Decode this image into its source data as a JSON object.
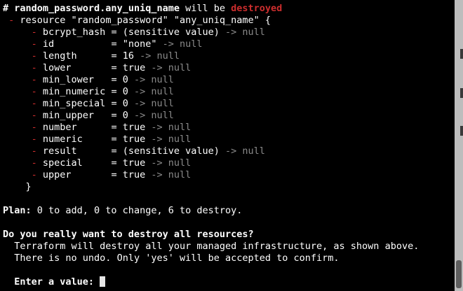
{
  "terminal": {
    "header": {
      "hash": "# ",
      "resource_name": "random_password.any_uniq_name",
      "will_be": " will be ",
      "action": "destroyed"
    },
    "resource_open": {
      "minus": "- ",
      "text": "resource \"random_password\" \"any_uniq_name\" {"
    },
    "attributes": [
      {
        "name": "bcrypt_hash = ",
        "value": "(sensitive value)",
        "arrow": " -> null"
      },
      {
        "name": "id          = ",
        "value": "\"none\"",
        "arrow": " -> null"
      },
      {
        "name": "length      = ",
        "value": "16",
        "arrow": " -> null"
      },
      {
        "name": "lower       = ",
        "value": "true",
        "arrow": " -> null"
      },
      {
        "name": "min_lower   = ",
        "value": "0",
        "arrow": " -> null"
      },
      {
        "name": "min_numeric = ",
        "value": "0",
        "arrow": " -> null"
      },
      {
        "name": "min_special = ",
        "value": "0",
        "arrow": " -> null"
      },
      {
        "name": "min_upper   = ",
        "value": "0",
        "arrow": " -> null"
      },
      {
        "name": "number      = ",
        "value": "true",
        "arrow": " -> null"
      },
      {
        "name": "numeric     = ",
        "value": "true",
        "arrow": " -> null"
      },
      {
        "name": "result      = ",
        "value": "(sensitive value)",
        "arrow": " -> null"
      },
      {
        "name": "special     = ",
        "value": "true",
        "arrow": " -> null"
      },
      {
        "name": "upper       = ",
        "value": "true",
        "arrow": " -> null"
      }
    ],
    "resource_close": "}",
    "plan": {
      "label": "Plan:",
      "text": " 0 to add, 0 to change, 6 to destroy."
    },
    "prompt": {
      "question": "Do you really want to destroy all resources?",
      "line1": "Terraform will destroy all your managed infrastructure, as shown above.",
      "line2": "There is no undo. Only 'yes' will be accepted to confirm.",
      "input_label": "Enter a value:",
      "input_value": ""
    }
  },
  "colors": {
    "background": "#000000",
    "destroy_red": "#cd2e2e",
    "null_gray": "#8a8a8a",
    "text": "#ffffff"
  }
}
